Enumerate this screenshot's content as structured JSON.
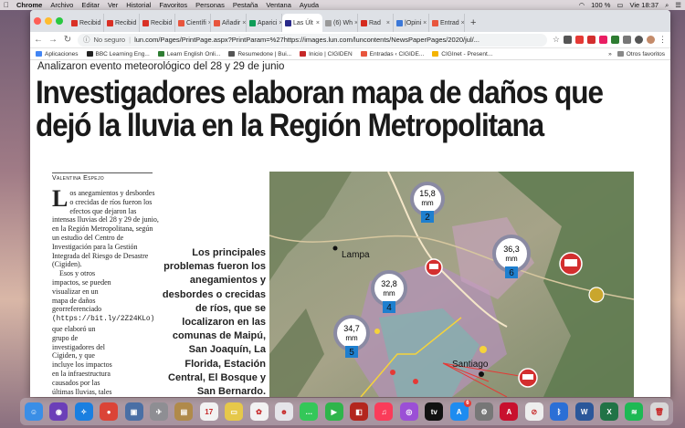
{
  "menubar": {
    "app": "Chrome",
    "items": [
      "Archivo",
      "Editar",
      "Ver",
      "Historial",
      "Favoritos",
      "Personas",
      "Pestaña",
      "Ventana",
      "Ayuda"
    ],
    "battery": "100 %",
    "clock": "Vie 18:37"
  },
  "tabs": [
    {
      "label": "Recibid",
      "color": "#d93025"
    },
    {
      "label": "Recibid",
      "color": "#d93025"
    },
    {
      "label": "Recibid",
      "color": "#d93025"
    },
    {
      "label": "Científi",
      "color": "#e8553d"
    },
    {
      "label": "Añadir",
      "color": "#e8553d"
    },
    {
      "label": "Aparici",
      "color": "#0f9d58"
    },
    {
      "label": "Las Últ",
      "color": "#2a2a8a"
    },
    {
      "label": "(6) Wh",
      "color": "#999999"
    },
    {
      "label": "Rad",
      "color": "#d52b1e"
    },
    {
      "label": "|Opini",
      "color": "#3b78d8"
    },
    {
      "label": "Entrad",
      "color": "#e8553d"
    }
  ],
  "active_tab_index": 6,
  "address": {
    "security": "No seguro",
    "url": "lun.com/Pages/PrintPage.aspx?PrintParam=%27https://images.lun.com/luncontents/NewsPaperPages/2020/jul/..."
  },
  "bookmarks": [
    {
      "label": "Aplicaciones",
      "color": "#4285f4"
    },
    {
      "label": "BBC Learning Eng...",
      "color": "#222222"
    },
    {
      "label": "Learn English Onli...",
      "color": "#2e7d32"
    },
    {
      "label": "Resumedone | Bui...",
      "color": "#555555"
    },
    {
      "label": "Inicio | CIGIDEN",
      "color": "#c62828"
    },
    {
      "label": "Entradas ‹ CIGIDE...",
      "color": "#e8553d"
    },
    {
      "label": "CIGInet - Present...",
      "color": "#f4b400"
    }
  ],
  "bookmarks_more": "»",
  "bookmarks_other": "Otros favoritos",
  "article": {
    "kicker": "Analizaron evento meteorológico del 28 y 29 de junio",
    "headline": "Investigadores elaboran mapa de daños que dejó la lluvia en la Región Metropolitana",
    "byline": "Valentina Espejo",
    "drop_cap": "L",
    "p1": "os anegamientos y desbordes o crecidas de ríos fueron los efectos que dejaron las intensas lluvias del 28 y 29 de junio, en la Región Metropolitana, según un estudio del Centro de Investigación para la Gestión Integrada del Riesgo de Desastre (Cigiden).",
    "p2a": "Esos y otros impactos, se pueden visualizar en un mapa de daños georreferenciado",
    "p2_link": "(https://bit.ly/2Z24KLo)",
    "p2b": "que elaboró un grupo de investigadores del Cigiden, y que incluye los impactos en la infraestructura causados por las últimas lluvias, tales como anegamientos, fallas y cortes de caminos, caída de rocas y desborde de",
    "pull_quote": "Los principales problemas fueron los anegamientos y desbordes o crecidas de ríos, que se localizaron en las comunas de Maipú, San Joaquín, La Florida, Estación Central, El Bosque y San Bernardo."
  },
  "map": {
    "places": [
      "Lampa",
      "Santiago"
    ],
    "stations": [
      {
        "value": "15,8",
        "unit": "mm",
        "id": "2"
      },
      {
        "value": "36,3",
        "unit": "mm",
        "id": "6"
      },
      {
        "value": "32,8",
        "unit": "mm",
        "id": "4"
      },
      {
        "value": "34,7",
        "unit": "mm",
        "id": "5"
      }
    ]
  },
  "dock": [
    {
      "name": "finder-icon",
      "color": "#3a8ee6",
      "glyph": "☺"
    },
    {
      "name": "siri-icon",
      "color": "#6b3fb8",
      "glyph": "◉"
    },
    {
      "name": "safari-icon",
      "color": "#1a7fe0",
      "glyph": "✧"
    },
    {
      "name": "chrome-icon",
      "color": "#db4437",
      "glyph": "●"
    },
    {
      "name": "preview-icon",
      "color": "#4a6fa5",
      "glyph": "▣"
    },
    {
      "name": "launchpad-icon",
      "color": "#8e8e93",
      "glyph": "✈"
    },
    {
      "name": "notes-icon",
      "color": "#b08a4a",
      "glyph": "▤"
    },
    {
      "name": "calendar-icon",
      "color": "#f2f2f2",
      "glyph": "17"
    },
    {
      "name": "stickies-icon",
      "color": "#e6c84a",
      "glyph": "▭"
    },
    {
      "name": "photos-icon",
      "color": "#f2f2f2",
      "glyph": "✿"
    },
    {
      "name": "people-icon",
      "color": "#e5e5ea",
      "glyph": "☻"
    },
    {
      "name": "messages-icon",
      "color": "#34c759",
      "glyph": "…"
    },
    {
      "name": "facetime-icon",
      "color": "#2fb54b",
      "glyph": "▶"
    },
    {
      "name": "photo-booth-icon",
      "color": "#b3261e",
      "glyph": "◧"
    },
    {
      "name": "music-icon",
      "color": "#fa3c5a",
      "glyph": "♫"
    },
    {
      "name": "podcasts-icon",
      "color": "#9b4fd6",
      "glyph": "◎"
    },
    {
      "name": "appletv-icon",
      "color": "#111111",
      "glyph": "tv"
    },
    {
      "name": "appstore-icon",
      "color": "#1e8cf0",
      "glyph": "A"
    },
    {
      "name": "system-preferences-icon",
      "color": "#777777",
      "glyph": "⚙"
    },
    {
      "name": "acrobat-icon",
      "color": "#c8102e",
      "glyph": "A"
    },
    {
      "name": "no-entry-icon",
      "color": "#eeeeee",
      "glyph": "⊘"
    },
    {
      "name": "bluetooth-icon",
      "color": "#2b6fd6",
      "glyph": "ᛒ"
    },
    {
      "name": "word-icon",
      "color": "#2b579a",
      "glyph": "W"
    },
    {
      "name": "excel-icon",
      "color": "#217346",
      "glyph": "X"
    },
    {
      "name": "spotify-icon",
      "color": "#1db954",
      "glyph": "≋"
    },
    {
      "name": "trash-icon",
      "color": "#d8d8d8",
      "glyph": "🗑"
    }
  ],
  "dock_badge": "6"
}
